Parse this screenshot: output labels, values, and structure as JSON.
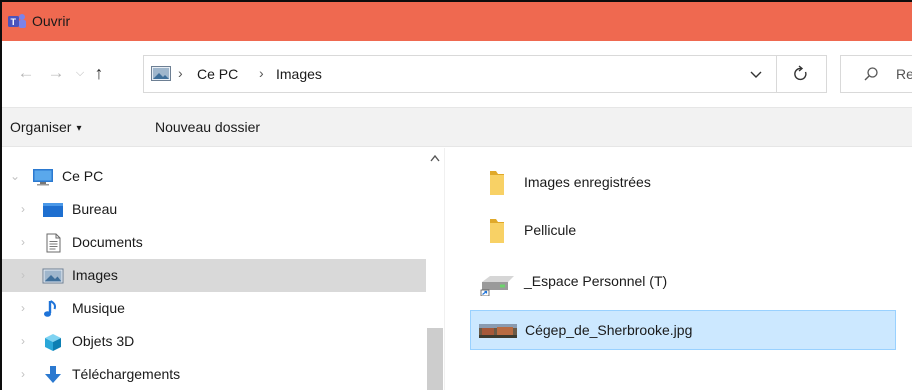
{
  "window": {
    "title": "Ouvrir",
    "accent_color": "#ef6950"
  },
  "navigation": {
    "back_icon": "arrow-left-icon",
    "forward_icon": "arrow-right-icon",
    "recent_icon": "chevron-down-icon",
    "up_icon": "arrow-up-icon"
  },
  "address_bar": {
    "icon": "images-folder-icon",
    "segments": [
      "Ce PC",
      "Images"
    ],
    "separator": "›",
    "dropdown_icon": "chevron-down-icon",
    "refresh_icon": "refresh-icon"
  },
  "search": {
    "icon": "search-icon",
    "placeholder": "Re"
  },
  "toolbar": {
    "organize_label": "Organiser",
    "organize_caret": "▾",
    "new_folder_label": "Nouveau dossier"
  },
  "nav_pane": {
    "items": [
      {
        "label": "Ce PC",
        "icon": "computer-icon",
        "expanded": true,
        "selected": false
      },
      {
        "label": "Bureau",
        "icon": "desktop-icon",
        "expanded": false,
        "selected": false
      },
      {
        "label": "Documents",
        "icon": "documents-icon",
        "expanded": false,
        "selected": false
      },
      {
        "label": "Images",
        "icon": "images-icon",
        "expanded": false,
        "selected": true
      },
      {
        "label": "Musique",
        "icon": "music-icon",
        "expanded": false,
        "selected": false
      },
      {
        "label": "Objets 3D",
        "icon": "objects-3d-icon",
        "expanded": false,
        "selected": false
      },
      {
        "label": "Téléchargements",
        "icon": "downloads-icon",
        "expanded": false,
        "selected": false
      }
    ]
  },
  "content": {
    "items": [
      {
        "name": "Images enregistrées",
        "icon": "folder-icon",
        "selected": false
      },
      {
        "name": "Pellicule",
        "icon": "folder-icon",
        "selected": false
      },
      {
        "name": "_Espace Personnel (T)",
        "icon": "network-drive-shortcut-icon",
        "selected": false
      },
      {
        "name": "Cégep_de_Sherbrooke.jpg",
        "icon": "image-thumbnail-icon",
        "selected": true
      }
    ]
  }
}
